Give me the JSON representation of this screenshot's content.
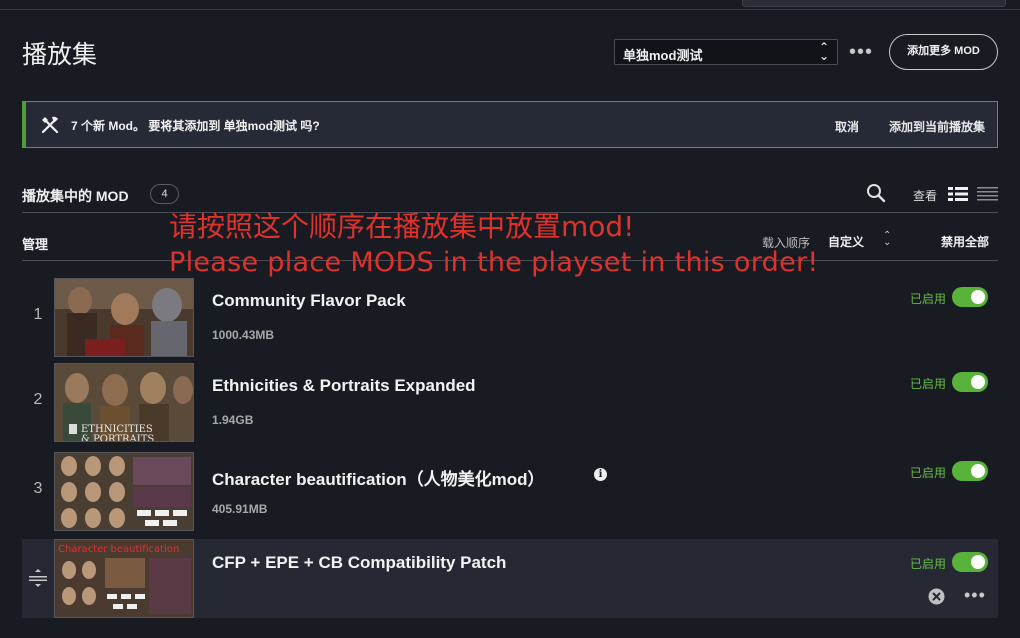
{
  "header": {
    "title": "播放集",
    "playset_value": "单独mod测试",
    "add_more_label": "添加更多 MOD"
  },
  "banner": {
    "message": "7 个新 Mod。 要将其添加到 单独mod测试 吗?",
    "cancel_label": "取消",
    "add_label": "添加到当前播放集"
  },
  "section": {
    "title": "播放集中的 MOD",
    "count": "4",
    "view_label": "查看"
  },
  "controls": {
    "manage_label": "管理",
    "load_order_label": "载入顺序",
    "sort_value": "自定义",
    "disable_all_label": "禁用全部"
  },
  "overlay": {
    "zh": "请按照这个顺序在播放集中放置mod!",
    "en": "Please place MODS in the playset in this order!"
  },
  "mods": [
    {
      "index": "1",
      "name": "Community Flavor Pack",
      "size": "1000.43MB",
      "status": "已启用",
      "enabled": true
    },
    {
      "index": "2",
      "name": "Ethnicities & Portraits Expanded",
      "size": "1.94GB",
      "status": "已启用",
      "enabled": true,
      "thumb_text_1": "ETHNICITIES",
      "thumb_text_2": "& PORTRAITS"
    },
    {
      "index": "3",
      "name": "Character beautification（人物美化mod）",
      "size": "405.91MB",
      "status": "已启用",
      "enabled": true
    },
    {
      "index": "",
      "name": "CFP + EPE + CB Compatibility Patch",
      "size": "",
      "status": "已启用",
      "enabled": true,
      "thumb_text_1": "Character beautification"
    }
  ],
  "colors": {
    "background": "#191b23",
    "accent_green": "#59b33a",
    "enabled_text": "#66bb44",
    "banner_border": "#4f9e3a",
    "overlay_red": "#e0312b"
  }
}
